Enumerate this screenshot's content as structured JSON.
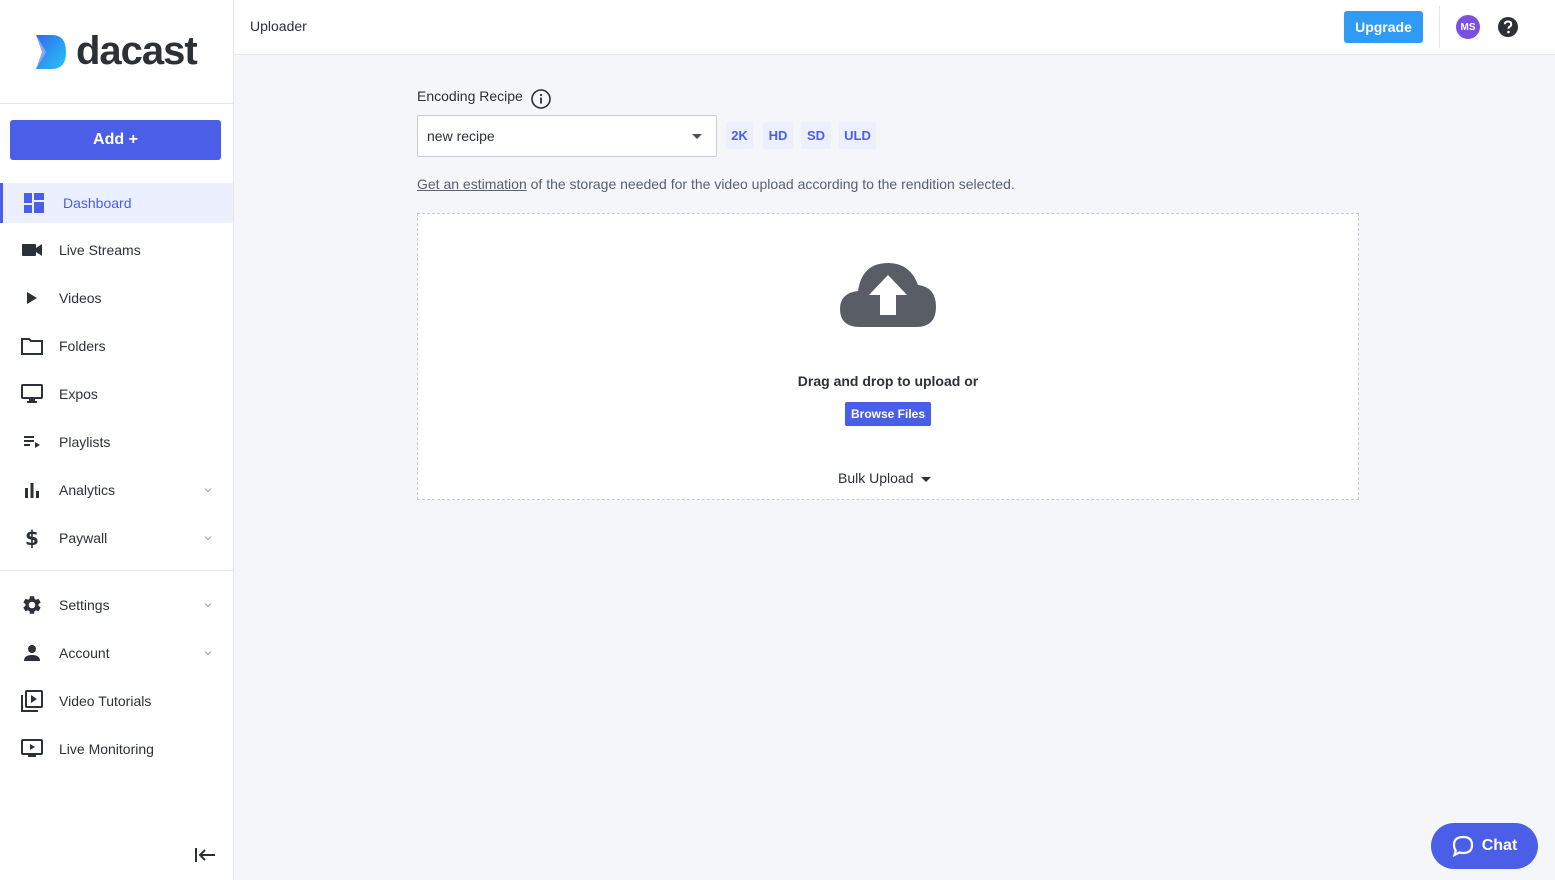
{
  "brand": {
    "name": "dacast",
    "accent": "#4b5ee8"
  },
  "sidebar": {
    "add_label": "Add +",
    "items": [
      {
        "label": "Dashboard",
        "icon": "dashboard-icon",
        "active": true
      },
      {
        "label": "Live Streams",
        "icon": "video-camera-icon"
      },
      {
        "label": "Videos",
        "icon": "play-icon"
      },
      {
        "label": "Folders",
        "icon": "folder-icon"
      },
      {
        "label": "Expos",
        "icon": "monitor-icon"
      },
      {
        "label": "Playlists",
        "icon": "playlist-icon"
      },
      {
        "label": "Analytics",
        "icon": "bar-chart-icon",
        "expandable": true
      },
      {
        "label": "Paywall",
        "icon": "dollar-icon",
        "expandable": true
      }
    ],
    "secondary_items": [
      {
        "label": "Settings",
        "icon": "gear-icon",
        "expandable": true
      },
      {
        "label": "Account",
        "icon": "person-icon",
        "expandable": true
      },
      {
        "label": "Video Tutorials",
        "icon": "video-library-icon"
      },
      {
        "label": "Live Monitoring",
        "icon": "live-monitor-icon"
      }
    ]
  },
  "header": {
    "title": "Uploader",
    "upgrade_label": "Upgrade",
    "avatar_initials": "MS"
  },
  "main": {
    "recipe_label": "Encoding Recipe",
    "recipe_value": "new recipe",
    "renditions": [
      "2K",
      "HD",
      "SD",
      "ULD"
    ],
    "estimation_link": "Get an estimation",
    "estimation_text": " of the storage needed for the video upload according to the rendition selected.",
    "dropzone": {
      "text": "Drag and drop to upload or",
      "browse_label": "Browse Files",
      "bulk_label": "Bulk Upload"
    }
  },
  "chat": {
    "label": "Chat"
  }
}
